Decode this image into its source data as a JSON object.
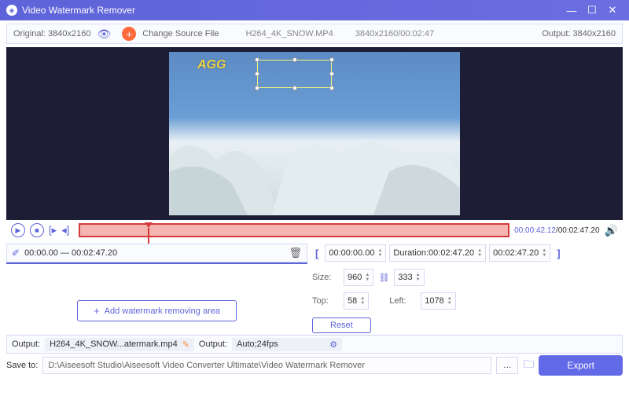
{
  "titlebar": {
    "title": "Video Watermark Remover"
  },
  "infobar": {
    "original_label": "Original: 3840x2160",
    "change_label": "Change Source File",
    "filename": "H264_4K_SNOW.MP4",
    "resolution_time": "3840x2160/00:02:47",
    "output_label": "Output: 3840x2160"
  },
  "preview": {
    "logo_text": "AGG"
  },
  "playback": {
    "current": "00:00:42.12",
    "total": "/00:02:47.20"
  },
  "range": {
    "text": "00:00.00 — 00:02:47.20"
  },
  "trim": {
    "start": "00:00:00.00",
    "duration_label": "Duration:00:02:47.20",
    "end": "00:02:47.20"
  },
  "size": {
    "size_label": "Size:",
    "width": "960",
    "height": "333",
    "top_label": "Top:",
    "top": "58",
    "left_label": "Left:",
    "left": "1078"
  },
  "buttons": {
    "reset": "Reset",
    "add_area": "Add watermark removing area",
    "export": "Export"
  },
  "output": {
    "label1": "Output:",
    "filename": "H264_4K_SNOW...atermark.mp4",
    "label2": "Output:",
    "format": "Auto;24fps"
  },
  "save": {
    "label": "Save to:",
    "path": "D:\\Aiseesoft Studio\\Aiseesoft Video Converter Ultimate\\Video Watermark Remover"
  }
}
